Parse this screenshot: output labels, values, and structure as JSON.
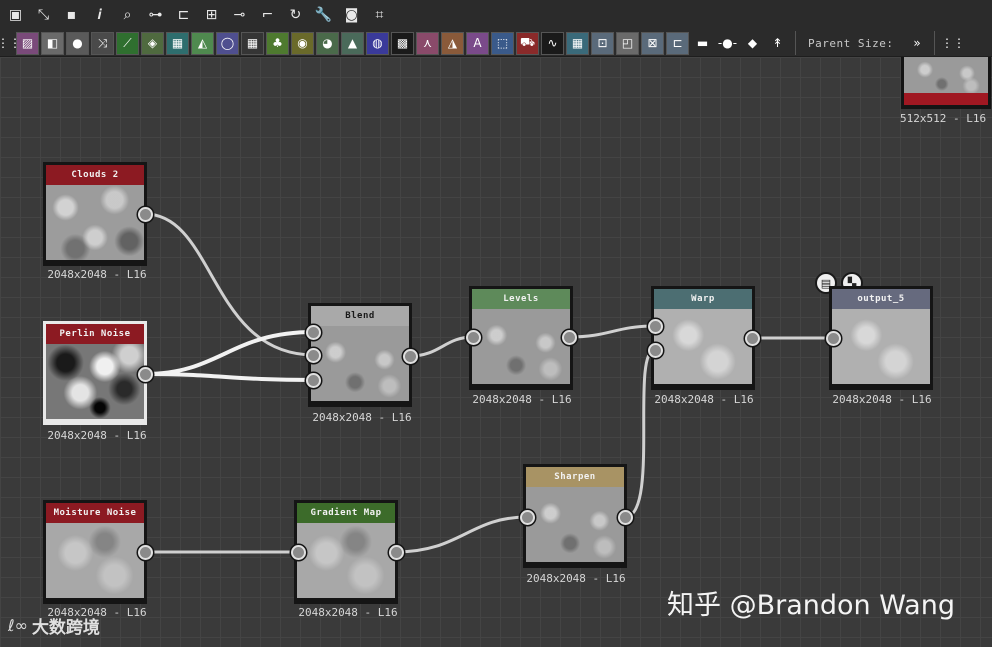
{
  "toolbar": {
    "row1_icons": [
      {
        "name": "frame-icon",
        "glyph": "▣"
      },
      {
        "name": "fit-view-icon",
        "glyph": "⤡"
      },
      {
        "name": "camera-icon",
        "glyph": "▪"
      },
      {
        "name": "info-icon",
        "glyph": "𝒊"
      },
      {
        "name": "search-icon",
        "glyph": "⌕"
      },
      {
        "name": "link-icon",
        "glyph": "⊶"
      },
      {
        "name": "align-icon",
        "glyph": "⊏"
      },
      {
        "name": "layout-icon",
        "glyph": "⊞"
      },
      {
        "name": "reroute-icon",
        "glyph": "⊸"
      },
      {
        "name": "connect-icon",
        "glyph": "⌐"
      },
      {
        "name": "refresh-icon",
        "glyph": "↻"
      },
      {
        "name": "wrench-icon",
        "glyph": "🔧"
      },
      {
        "name": "preview-icon",
        "glyph": "◙"
      },
      {
        "name": "crop-icon",
        "glyph": "⌗"
      }
    ],
    "row2_icons": [
      {
        "name": "image-icon",
        "glyph": "▨",
        "bg": "#7a4a7a"
      },
      {
        "name": "blend-icon",
        "glyph": "◧",
        "bg": "#6a6a6a"
      },
      {
        "name": "drop-icon",
        "glyph": "●",
        "bg": "#5a5a5a"
      },
      {
        "name": "shuffle-icon",
        "glyph": "⤨",
        "bg": "#4a4a4a"
      },
      {
        "name": "curve-icon",
        "glyph": "⟋",
        "bg": "#2f6f2f"
      },
      {
        "name": "levels-icon",
        "glyph": "◈",
        "bg": "#4f6a3f"
      },
      {
        "name": "warp-icon",
        "glyph": "▦",
        "bg": "#2e6e6e"
      },
      {
        "name": "gradient-icon",
        "glyph": "◭",
        "bg": "#4f8a4f"
      },
      {
        "name": "circle-icon",
        "glyph": "◯",
        "bg": "#4f4f8f"
      },
      {
        "name": "grid-icon",
        "glyph": "▦",
        "bg": "#353535"
      },
      {
        "name": "kettle-icon",
        "glyph": "♣",
        "bg": "#4e7a2f"
      },
      {
        "name": "dots-icon",
        "glyph": "◉",
        "bg": "#6a6a2a"
      },
      {
        "name": "sphere-icon",
        "glyph": "◕",
        "bg": "#4a6a4a"
      },
      {
        "name": "ramp-icon",
        "glyph": "▲",
        "bg": "#4a6a5a"
      },
      {
        "name": "hue-icon",
        "glyph": "◍",
        "bg": "#3a3a9a"
      },
      {
        "name": "dither-icon",
        "glyph": "▩",
        "bg": "#1a1a1a"
      },
      {
        "name": "curve-edit-icon",
        "glyph": "⋏",
        "bg": "#8a4a6a"
      },
      {
        "name": "triangle-icon",
        "glyph": "◮",
        "bg": "#8a5a3a"
      },
      {
        "name": "text-icon",
        "glyph": "A",
        "bg": "#7a4a8a"
      },
      {
        "name": "select-icon",
        "glyph": "⬚",
        "bg": "#3a5a8a"
      },
      {
        "name": "fill-icon",
        "glyph": "⛟",
        "bg": "#8a2a2a"
      },
      {
        "name": "wave-icon",
        "glyph": "∿",
        "bg": "#1a1a1a"
      },
      {
        "name": "texture-icon",
        "glyph": "▦",
        "bg": "#3a6a7a"
      },
      {
        "name": "transform-icon",
        "glyph": "⊡",
        "bg": "#5a6a7a"
      },
      {
        "name": "tile-icon",
        "glyph": "◰",
        "bg": "#6a6a6a"
      },
      {
        "name": "export-icon",
        "glyph": "⊠",
        "bg": "#5a6a7a"
      },
      {
        "name": "output-icon",
        "glyph": "⊏",
        "bg": "#5a6a7a"
      }
    ],
    "row2_plain_icons": [
      {
        "name": "comment-icon",
        "glyph": "▬"
      },
      {
        "name": "slider-icon",
        "glyph": "-●-"
      },
      {
        "name": "group-icon",
        "glyph": "◆"
      },
      {
        "name": "pin-icon",
        "glyph": "↟"
      }
    ],
    "parent_size_label": "Parent Size:",
    "expand_glyph": "»",
    "grip_glyph": "⋮⋮"
  },
  "nodes": {
    "clouds": {
      "title": "Clouds 2",
      "color": "#8c1a22",
      "res": "2048x2048 - L16"
    },
    "perlin": {
      "title": "Perlin Noise",
      "color": "#8c1a22",
      "res": "2048x2048 - L16"
    },
    "moisture": {
      "title": "Moisture Noise",
      "color": "#8c1a22",
      "res": "2048x2048 - L16"
    },
    "blend": {
      "title": "Blend",
      "color": "#a9a9a9",
      "res": "2048x2048 - L16"
    },
    "levels": {
      "title": "Levels",
      "color": "#5e8a5a",
      "res": "2048x2048 - L16"
    },
    "warp": {
      "title": "Warp",
      "color": "#4c6e72",
      "res": "2048x2048 - L16"
    },
    "output": {
      "title": "output_5",
      "color": "#666a7e",
      "res": "2048x2048 - L16"
    },
    "gradient_map": {
      "title": "Gradient Map",
      "color": "#3c6b2a",
      "res": "2048x2048 - L16"
    },
    "sharpen": {
      "title": "Sharpen",
      "color": "#a89364",
      "res": "2048x2048 - L16"
    },
    "corner": {
      "res": "512x512 - L16"
    }
  },
  "node_actions": [
    {
      "name": "document-icon",
      "glyph": "▤"
    },
    {
      "name": "checker-icon",
      "glyph": "▚"
    }
  ],
  "watermark": "知乎 @Brandon Wang",
  "logo": {
    "glyph": "ℓ∞",
    "text": "大数跨境"
  }
}
